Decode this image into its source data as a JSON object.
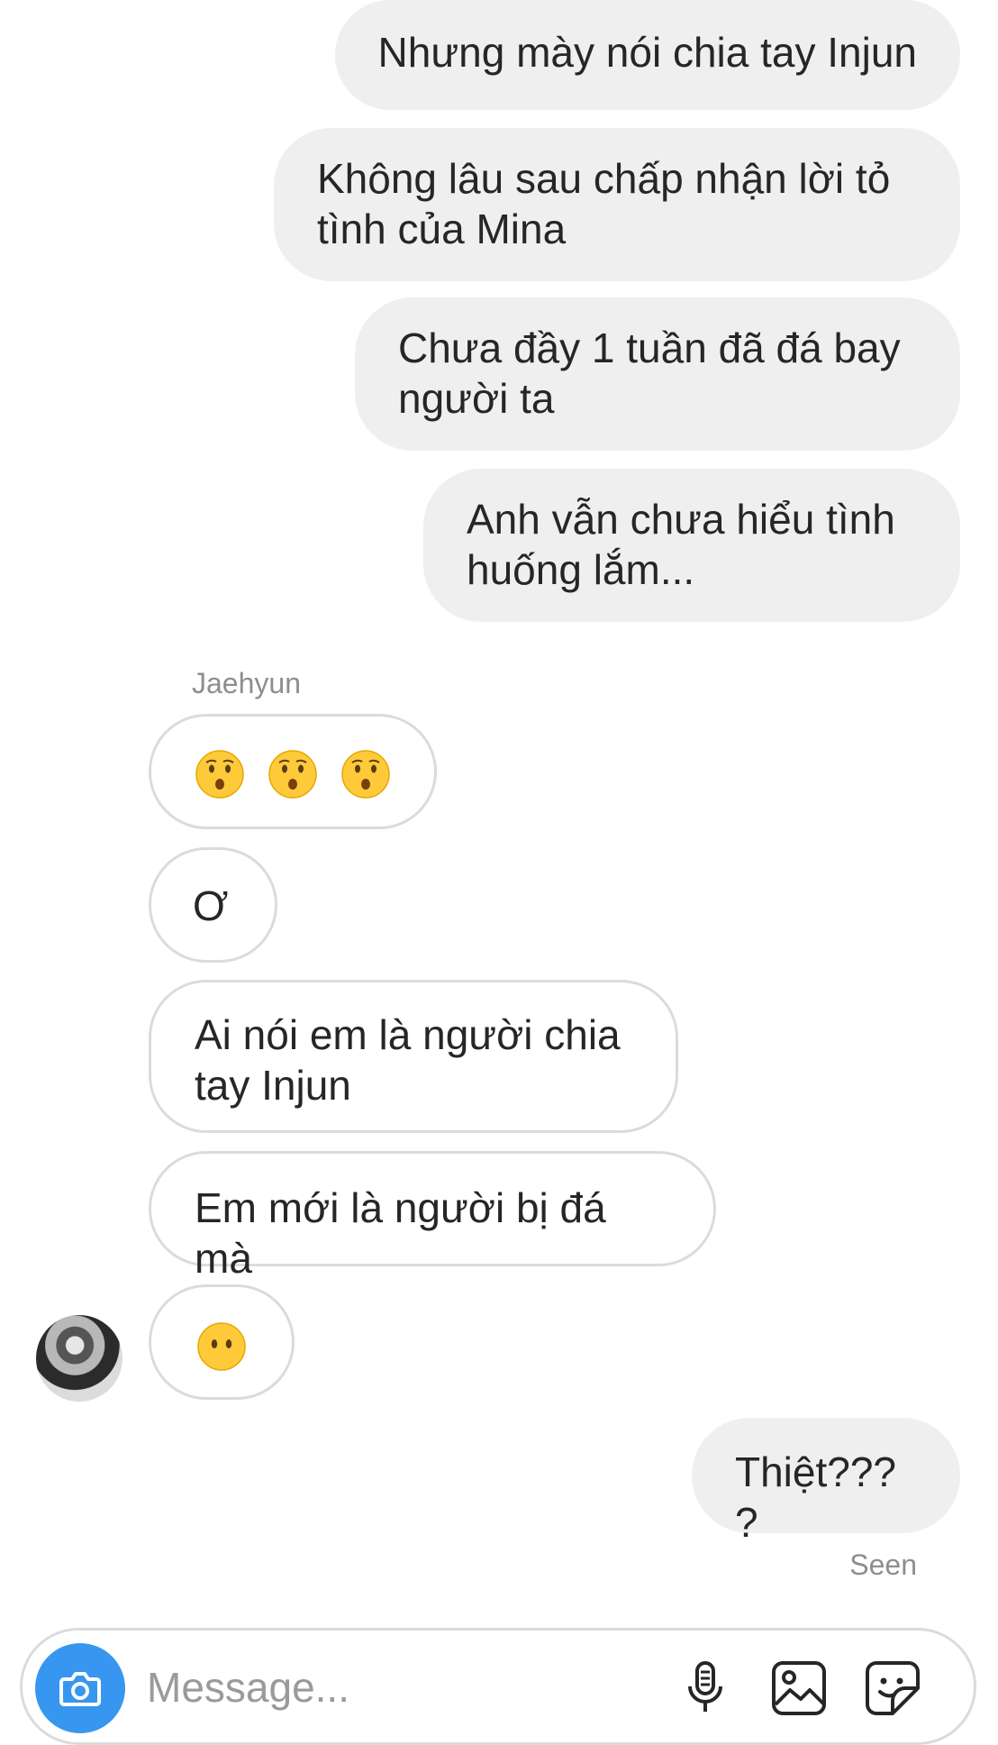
{
  "conversation": {
    "sender_name": "Jaehyun",
    "seen_label": "Seen",
    "messages": [
      {
        "side": "outgoing",
        "text": "Nhưng mày nói chia tay Injun"
      },
      {
        "side": "outgoing",
        "text": "Không lâu sau chấp nhận lời tỏ tình của Mina"
      },
      {
        "side": "outgoing",
        "text": "Chưa đầy 1 tuần đã đá bay người ta"
      },
      {
        "side": "outgoing",
        "text": "Anh vẫn chưa hiểu tình huống lắm..."
      },
      {
        "side": "incoming",
        "emoji": [
          "hushed-face",
          "hushed-face",
          "hushed-face"
        ]
      },
      {
        "side": "incoming",
        "text": "Ơ"
      },
      {
        "side": "incoming",
        "text": "Ai nói em là người chia tay Injun"
      },
      {
        "side": "incoming",
        "text": "Em mới là người bị đá mà"
      },
      {
        "side": "incoming",
        "emoji": [
          "face-without-mouth"
        ]
      },
      {
        "side": "outgoing",
        "text": "Thiệt????"
      }
    ]
  },
  "composer": {
    "placeholder": "Message...",
    "icons": [
      "camera-icon",
      "microphone-icon",
      "gallery-icon",
      "sticker-icon"
    ],
    "accent": "#3797f0"
  }
}
